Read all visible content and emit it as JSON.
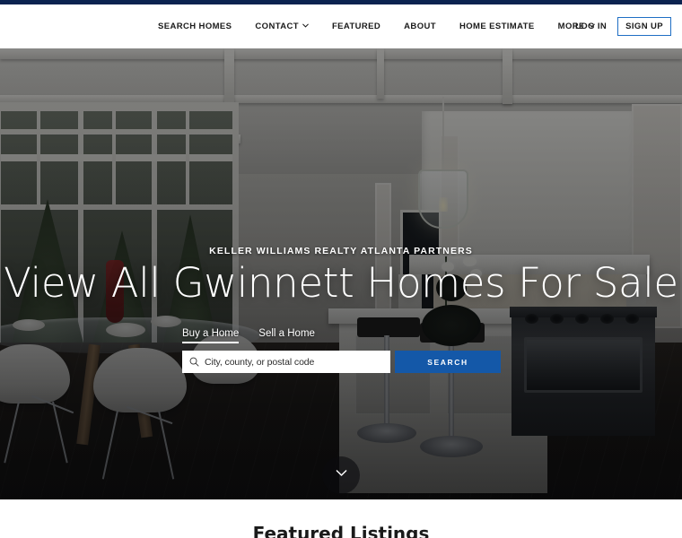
{
  "header": {
    "nav": [
      {
        "label": "SEARCH HOMES",
        "has_chevron": false
      },
      {
        "label": "CONTACT",
        "has_chevron": true
      },
      {
        "label": "FEATURED",
        "has_chevron": false
      },
      {
        "label": "ABOUT",
        "has_chevron": false
      },
      {
        "label": "HOME ESTIMATE",
        "has_chevron": false
      },
      {
        "label": "MORE",
        "has_chevron": true
      }
    ],
    "login_label": "LOG IN",
    "signup_label": "SIGN UP",
    "accent_color": "#1f6fc4",
    "top_strip_color": "#0b2350"
  },
  "hero": {
    "eyebrow": "KELLER WILLIAMS REALTY ATLANTA PARTNERS",
    "headline": "View All Gwinnett Homes For Sale",
    "tabs": [
      {
        "label": "Buy a Home",
        "active": true
      },
      {
        "label": "Sell a Home",
        "active": false
      }
    ],
    "search": {
      "placeholder": "City, county, or postal code",
      "value": "",
      "button_label": "SEARCH",
      "button_color": "#1458a8",
      "icon": "search-icon"
    },
    "scroll_icon": "chevron-down-icon"
  },
  "below_hero": {
    "featured_title": "Featured Listings"
  }
}
